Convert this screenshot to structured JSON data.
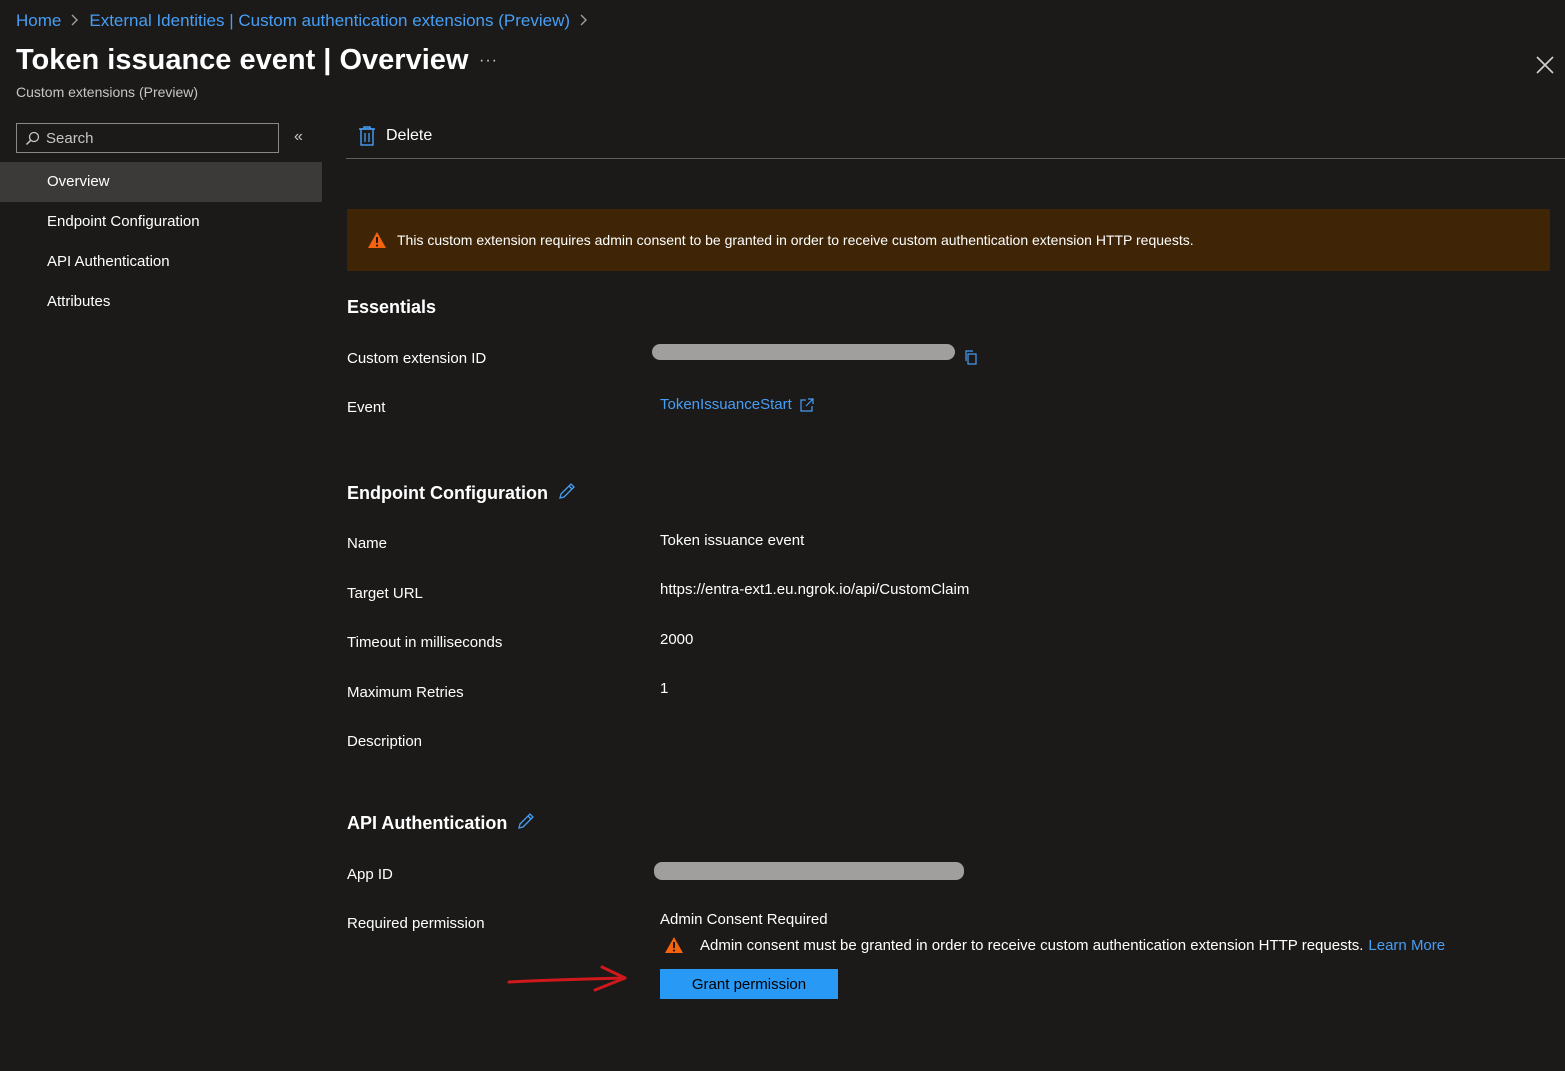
{
  "breadcrumb": {
    "home": "Home",
    "parent": "External Identities | Custom authentication extensions (Preview)"
  },
  "header": {
    "title_bold": "Token issuance event",
    "title_rest": " | Overview",
    "more": "···",
    "subtitle": "Custom extensions (Preview)"
  },
  "sidebar": {
    "search_placeholder": "Search",
    "collapse": "«",
    "items": [
      {
        "label": "Overview",
        "active": true
      },
      {
        "label": "Endpoint Configuration",
        "active": false
      },
      {
        "label": "API Authentication",
        "active": false
      },
      {
        "label": "Attributes",
        "active": false
      }
    ]
  },
  "toolbar": {
    "delete_label": "Delete"
  },
  "banner": {
    "text": "This custom extension requires admin consent to be granted in order to receive custom authentication extension HTTP requests."
  },
  "essentials": {
    "heading": "Essentials",
    "custom_extension_id_label": "Custom extension ID",
    "event_label": "Event",
    "event_value": "TokenIssuanceStart"
  },
  "endpoint": {
    "heading": "Endpoint Configuration",
    "name_label": "Name",
    "name_value": "Token issuance event",
    "target_url_label": "Target URL",
    "target_url_value": "https://entra-ext1.eu.ngrok.io/api/CustomClaim",
    "timeout_label": "Timeout in milliseconds",
    "timeout_value": "2000",
    "retries_label": "Maximum Retries",
    "retries_value": "1",
    "description_label": "Description"
  },
  "api_auth": {
    "heading": "API Authentication",
    "app_id_label": "App ID",
    "required_permission_label": "Required permission",
    "status": "Admin Consent Required",
    "consent_message": "Admin consent must be granted in order to receive custom authentication extension HTTP requests.",
    "learn_more": "Learn More",
    "grant_button": "Grant permission"
  },
  "colors": {
    "background": "#1b1a19",
    "link": "#479ef5",
    "banner": "#3f2506",
    "warning": "#f7630c",
    "primary_button": "#2899f5",
    "annotation": "#d0191c"
  }
}
